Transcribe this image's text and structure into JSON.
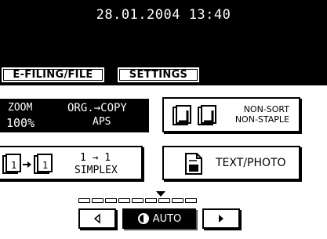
{
  "status": {
    "datetime": "28.01.2004 13:40"
  },
  "tabs": {
    "efiling": "E-FILING/FILE",
    "settings": "SETTINGS"
  },
  "zoom": {
    "label": "ZOOM",
    "value": "100%",
    "orgcopy": "ORG.→COPY",
    "paper": "APS"
  },
  "finishing": {
    "line1": "NON-SORT",
    "line2": "NON-STAPLE",
    "icon": "copies-stack-icon"
  },
  "duplex": {
    "line1": "1 → 1",
    "line2": "SIMPLEX",
    "icon": "simplex-icon"
  },
  "image_mode": {
    "label": "TEXT/PHOTO",
    "icon": "document-icon"
  },
  "density": {
    "auto_label": "AUTO",
    "segments": 9,
    "level": 5
  }
}
